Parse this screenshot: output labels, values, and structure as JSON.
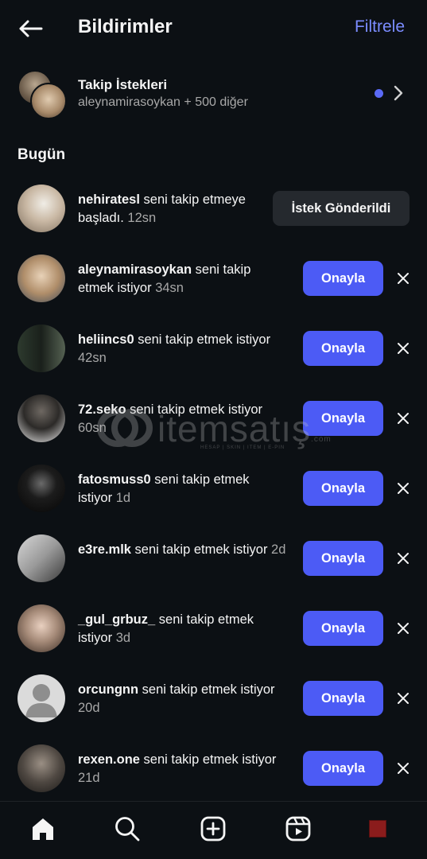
{
  "header": {
    "title": "Bildirimler",
    "filter_label": "Filtrele"
  },
  "follow_requests": {
    "title": "Takip İstekleri",
    "subtitle": "aleynamirasoykan + 500 diğer"
  },
  "section": {
    "today": "Bugün"
  },
  "notifications": [
    {
      "user": "nehiratesl",
      "text": " seni takip etmeye başladı.",
      "time": "12sn",
      "action": "İstek Gönderildi"
    },
    {
      "user": "aleynamirasoykan",
      "text": " seni takip etmek istiyor",
      "time": "34sn",
      "action": "Onayla"
    },
    {
      "user": "heliincs0",
      "text": " seni takip etmek istiyor",
      "time": "42sn",
      "action": "Onayla"
    },
    {
      "user": "72.seko",
      "text": " seni takip etmek istiyor",
      "time": "60sn",
      "action": "Onayla"
    },
    {
      "user": "fatosmuss0",
      "text": " seni takip etmek istiyor",
      "time": "1d",
      "action": "Onayla"
    },
    {
      "user": "e3re.mlk",
      "text": " seni takip etmek istiyor",
      "time": "2d",
      "action": "Onayla"
    },
    {
      "user": "_gul_grbuz_",
      "text": " seni takip etmek istiyor",
      "time": "3d",
      "action": "Onayla"
    },
    {
      "user": "orcungnn",
      "text": " seni takip etmek istiyor",
      "time": "20d",
      "action": "Onayla"
    },
    {
      "user": "rexen.one",
      "text": " seni takip etmek istiyor",
      "time": "21d",
      "action": "Onayla"
    }
  ],
  "watermark": {
    "brand": "itemsatış",
    "tagline": "HESAP | SKIN | ITEM | E-PIN",
    "domain": ".com"
  },
  "bottom_nav": [
    "home-icon",
    "search-icon",
    "create-icon",
    "reels-icon",
    "profile"
  ],
  "colors": {
    "background": "#0c1014",
    "accent": "#4c5bf5",
    "link": "#7b8cff",
    "muted": "#a8a8a8"
  }
}
